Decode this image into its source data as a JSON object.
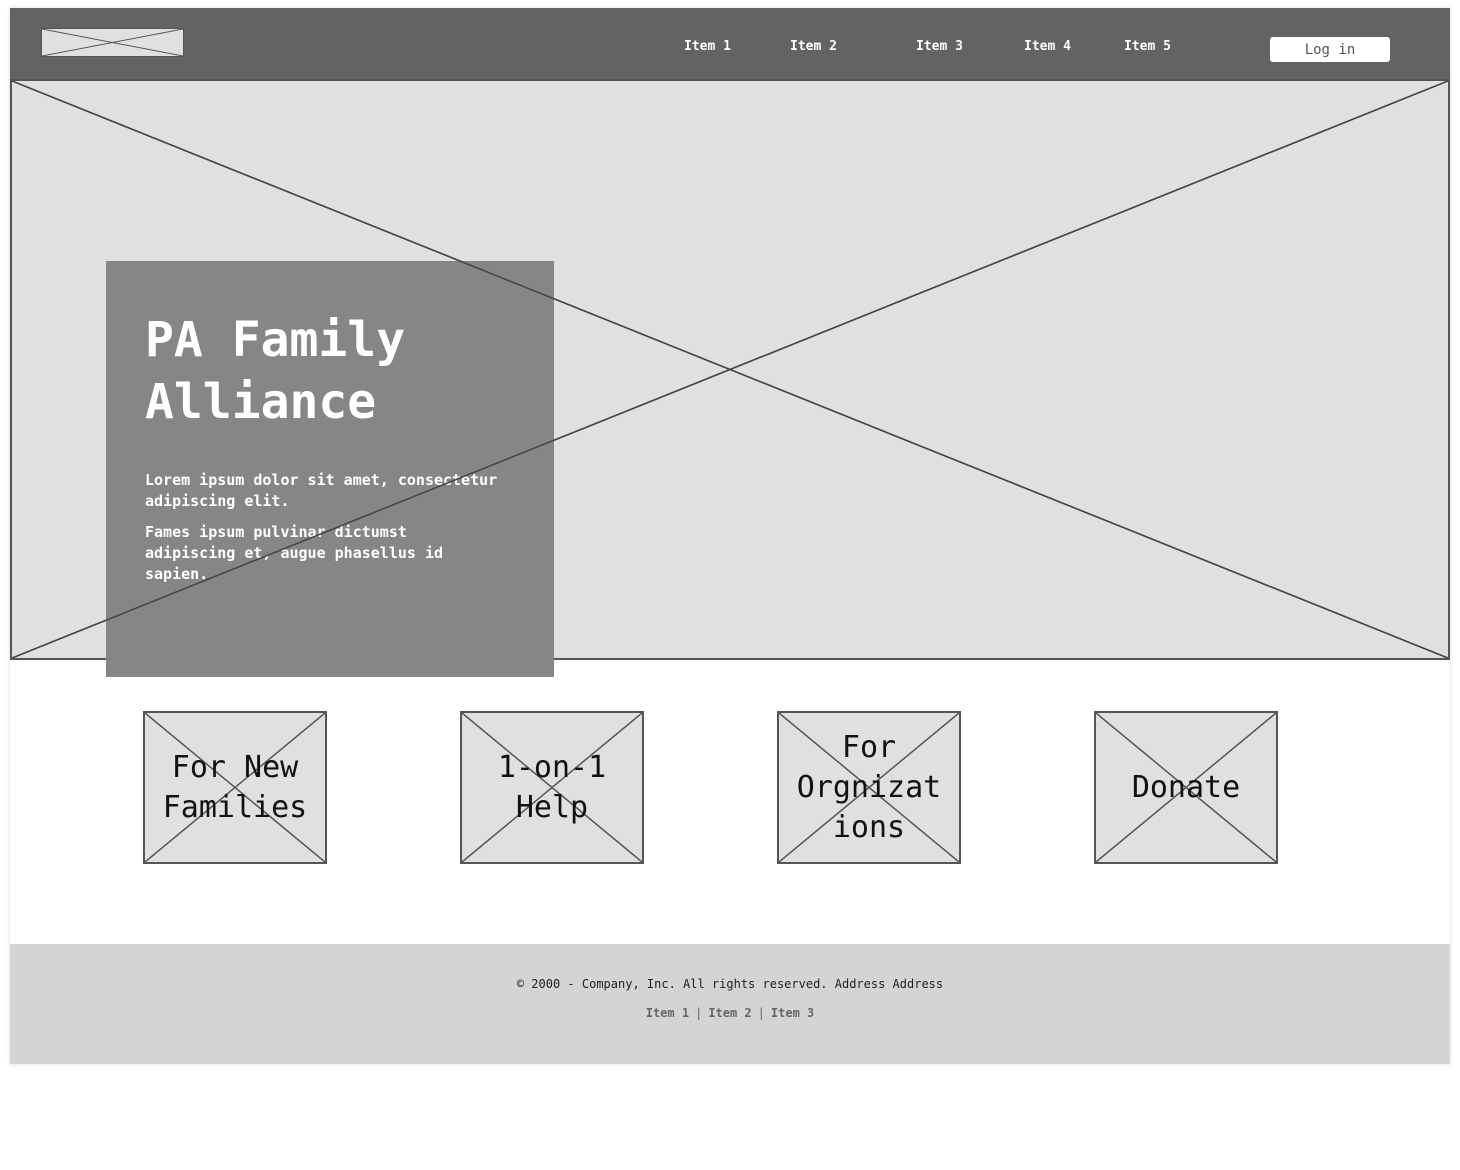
{
  "header": {
    "logo": "logo-placeholder",
    "nav": [
      "Item 1",
      "Item 2",
      "Item 3",
      "Item 4",
      "Item 5"
    ],
    "login_label": "Log in"
  },
  "hero": {
    "title_line1": "PA Family",
    "title_line2": "Alliance",
    "paragraph1": "Lorem ipsum dolor sit amet, consectetur adipiscing elit.",
    "paragraph2": "Fames ipsum pulvinar dictumst adipiscing et, augue phasellus id sapien."
  },
  "tiles": [
    {
      "line1": "For New",
      "line2": "Families",
      "line3": ""
    },
    {
      "line1": "1-on-1",
      "line2": "Help",
      "line3": ""
    },
    {
      "line1": "For",
      "line2": "Orgnizat",
      "line3": "ions"
    },
    {
      "line1": "Donate",
      "line2": "",
      "line3": ""
    }
  ],
  "footer": {
    "copyright": "© 2000 - Company, Inc. All rights reserved. Address Address",
    "links": [
      "Item 1",
      "Item 2",
      "Item 3"
    ],
    "separator": "|"
  },
  "colors": {
    "header_bg": "#636363",
    "placeholder_bg": "#e0e0e0",
    "hero_card_bg": "#868686",
    "footer_bg": "#d4d4d4"
  }
}
